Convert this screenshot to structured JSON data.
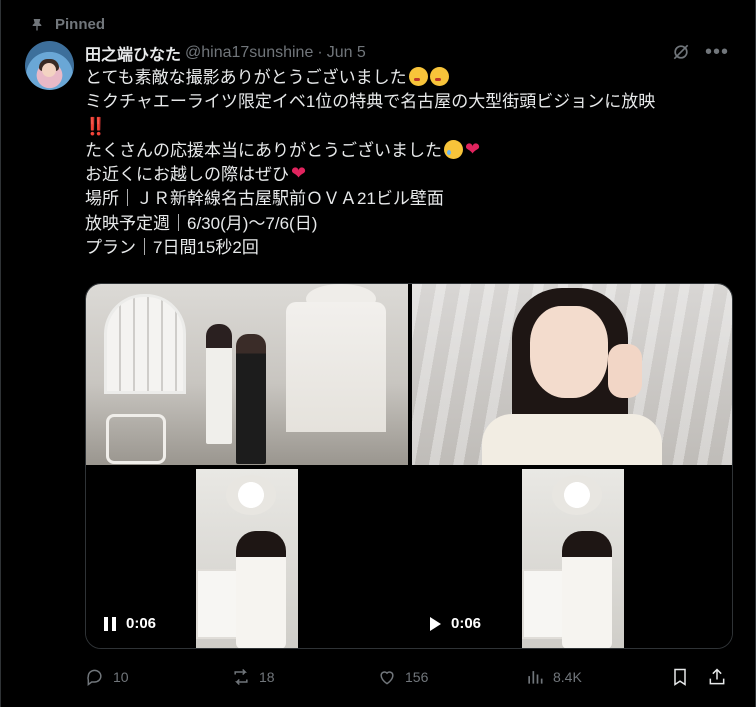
{
  "pinned_label": "Pinned",
  "author": {
    "name": "田之端ひなた",
    "handle": "@hina17sunshine",
    "separator": "·",
    "date": "Jun 5"
  },
  "body": {
    "line1": "とても素敵な撮影ありがとうございました",
    "line2": "ミクチャエーライツ限定イベ1位の特典で名古屋の大型街頭ビジョンに放映",
    "line2b": "‼️",
    "line3": "たくさんの応援本当にありがとうございました",
    "line4": "お近くにお越しの際はぜひ",
    "line5": "場所｜ＪＲ新幹線名古屋駅前ＯＶＡ21ビル壁面",
    "line6": "放映予定週｜6/30(月)〜7/6(日)",
    "line7": "プラン｜7日間15秒2回"
  },
  "media": {
    "video1_time": "0:06",
    "video2_time": "0:06"
  },
  "actions": {
    "replies": "10",
    "reposts": "18",
    "likes": "156",
    "views": "8.4K"
  },
  "icons": {
    "pin": "pin-icon",
    "grok": "grok-icon",
    "more": "more-icon",
    "reply": "reply-icon",
    "repost": "repost-icon",
    "like": "heart-icon",
    "views": "views-icon",
    "bookmark": "bookmark-icon",
    "share": "share-icon"
  },
  "colors": {
    "background": "#000000",
    "text": "#e7e9ea",
    "muted": "#71767b",
    "border": "#2f3336"
  }
}
